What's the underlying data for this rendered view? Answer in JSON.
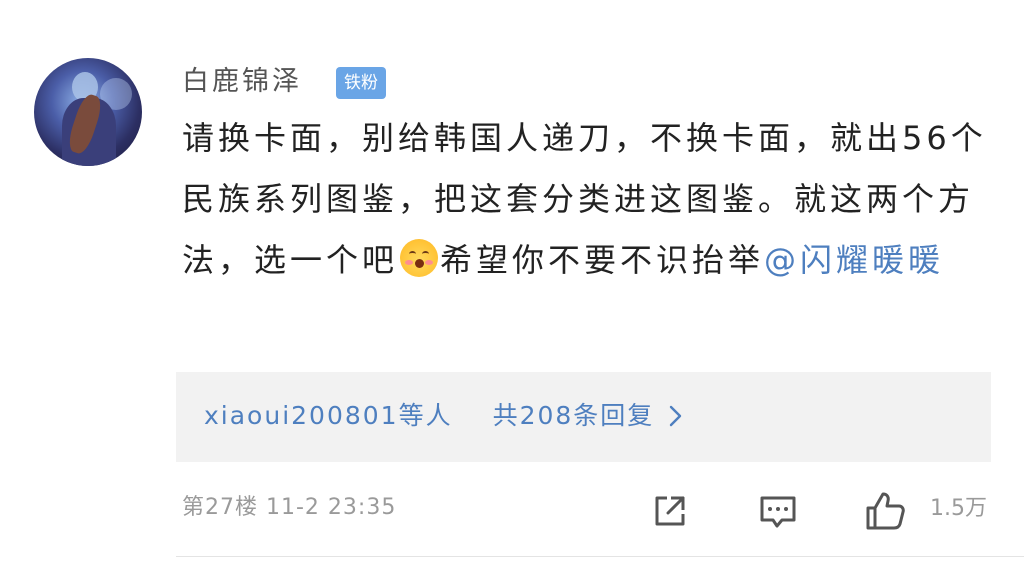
{
  "comment": {
    "username": "白鹿锦泽",
    "badge": "铁粉",
    "text_before_emoji": "请换卡面，别给韩国人递刀，不换卡面，就出56个民族系列图鉴，把这套分类进这图鉴。就这两个方法，选一个吧",
    "emoji_name": "smiling-blush-emoji",
    "text_after_emoji": "希望你不要不识抬举",
    "mention": "@闪耀暖暖",
    "replies": {
      "repliers": "xiaoui200801等人",
      "count_text": "共208条回复"
    },
    "meta": {
      "floor_time": "第27楼 11-2 23:35"
    },
    "actions": {
      "share_icon": "share-icon",
      "comment_icon": "comment-icon",
      "like_icon": "thumbs-up-icon",
      "like_count": "1.5万"
    }
  },
  "colors": {
    "badge": "#6aa5e6",
    "link": "#4e7fbf",
    "reply_bg": "#f2f2f2",
    "meta_text": "#9a9a9a"
  }
}
